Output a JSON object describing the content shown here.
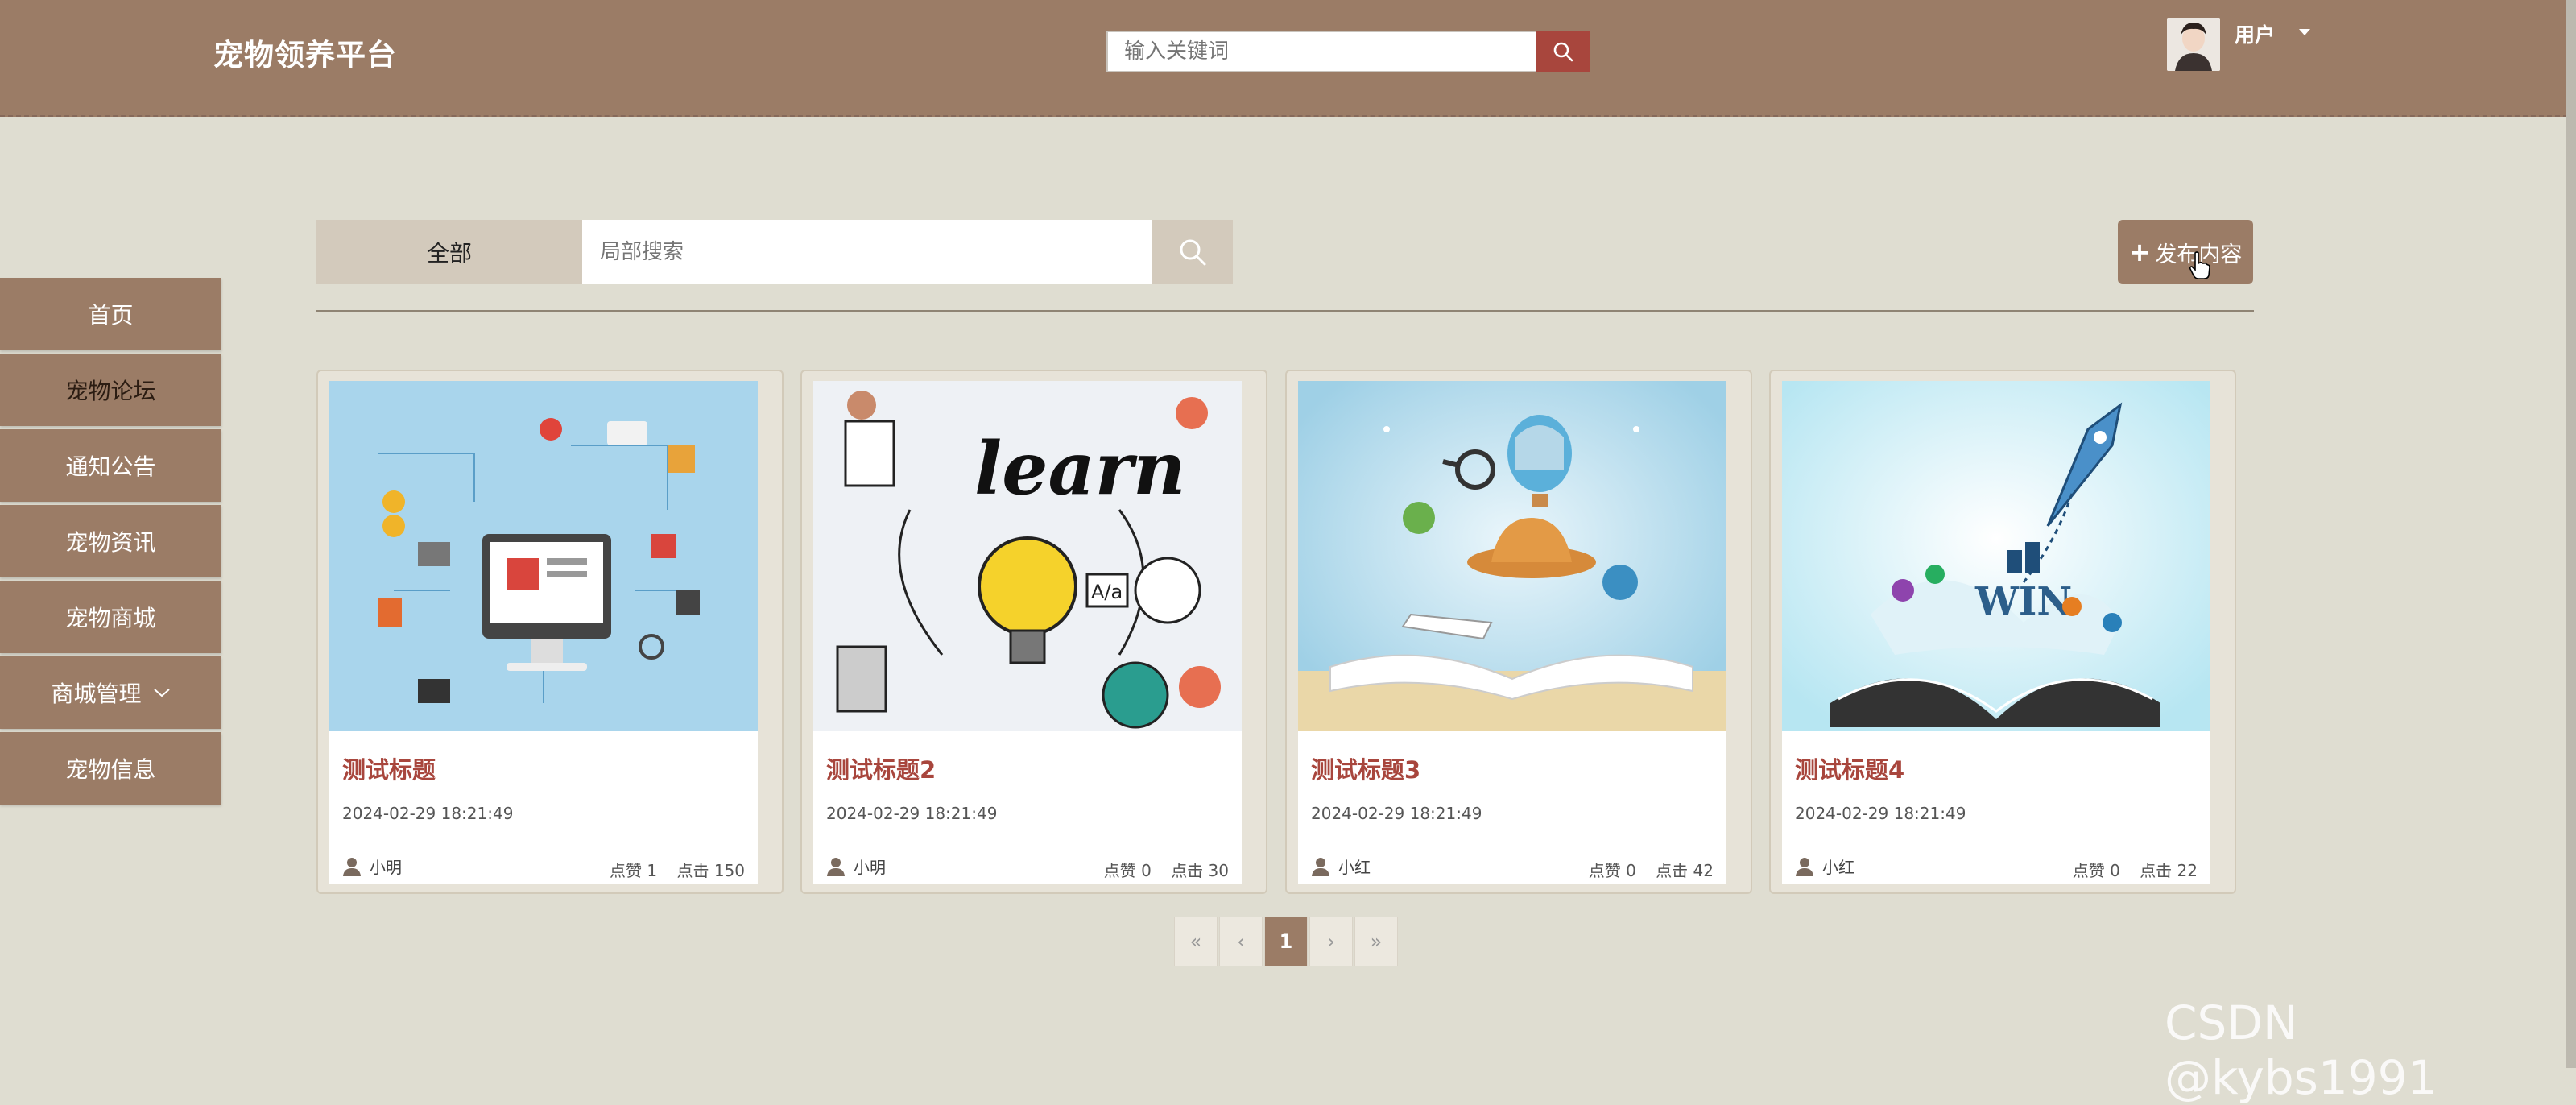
{
  "header": {
    "logo": "宠物领养平台",
    "search_placeholder": "输入关键词",
    "user_label": "用户"
  },
  "sidebar": {
    "items": [
      {
        "label": "首页"
      },
      {
        "label": "宠物论坛",
        "active": true
      },
      {
        "label": "通知公告"
      },
      {
        "label": "宠物资讯"
      },
      {
        "label": "宠物商城"
      },
      {
        "label": "商城管理",
        "has_submenu": true
      },
      {
        "label": "宠物信息"
      }
    ]
  },
  "filter": {
    "category_label": "全部",
    "search_placeholder": "局部搜索"
  },
  "publish_label": "发布内容",
  "posts": [
    {
      "title": "测试标题",
      "time": "2024-02-29 18:21:49",
      "author": "小明",
      "likes": "点赞 1",
      "clicks": "点击 150"
    },
    {
      "title": "测试标题2",
      "time": "2024-02-29 18:21:49",
      "author": "小明",
      "likes": "点赞 0",
      "clicks": "点击 30"
    },
    {
      "title": "测试标题3",
      "time": "2024-02-29 18:21:49",
      "author": "小红",
      "likes": "点赞 0",
      "clicks": "点击 42"
    },
    {
      "title": "测试标题4",
      "time": "2024-02-29 18:21:49",
      "author": "小红",
      "likes": "点赞 0",
      "clicks": "点击 22"
    }
  ],
  "pagination": {
    "first": "«",
    "prev": "‹",
    "current": "1",
    "next": "›",
    "last": "»"
  },
  "watermark": "CSDN @kybs1991",
  "colors": {
    "header": "#9b7c66",
    "accent": "#a8463d",
    "background": "#dfddd1"
  }
}
